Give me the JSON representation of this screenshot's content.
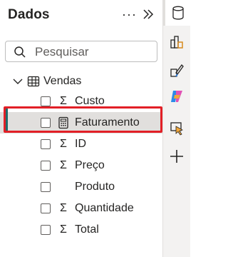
{
  "pane": {
    "title": "Dados",
    "more_icon": "more-horizontal-icon",
    "collapse_icon": "chevron-double-right-icon"
  },
  "search": {
    "placeholder": "Pesquisar",
    "icon": "search-icon"
  },
  "table": {
    "name": "Vendas",
    "expanded": true,
    "icon": "table-icon"
  },
  "fields": [
    {
      "label": "Custo",
      "icon": "sigma-icon",
      "symbol": "Σ",
      "checked": false
    },
    {
      "label": "Faturamento",
      "icon": "calculator-icon",
      "symbol": "",
      "checked": false,
      "selected": true
    },
    {
      "label": "ID",
      "icon": "sigma-icon",
      "symbol": "Σ",
      "checked": false
    },
    {
      "label": "Preço",
      "icon": "sigma-icon",
      "symbol": "Σ",
      "checked": false
    },
    {
      "label": "Produto",
      "icon": "",
      "symbol": "",
      "checked": false
    },
    {
      "label": "Quantidade",
      "icon": "sigma-icon",
      "symbol": "Σ",
      "checked": false
    },
    {
      "label": "Total",
      "icon": "sigma-icon",
      "symbol": "Σ",
      "checked": false
    }
  ],
  "rail": [
    "data-cylinder-icon",
    "build-visual-icon",
    "format-brush-icon",
    "copilot-icon",
    "selection-pointer-icon",
    "add-icon"
  ],
  "colors": {
    "highlight": "#e21f26",
    "selection_bar": "#1f6b6b",
    "selected_bg": "#e1dfdd"
  }
}
